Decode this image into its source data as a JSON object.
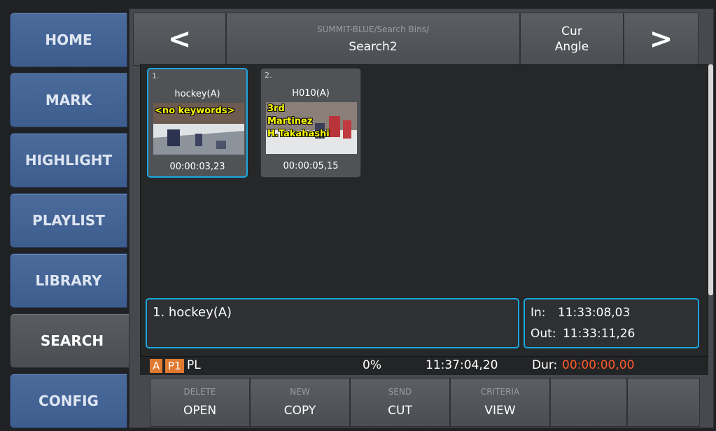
{
  "nav": {
    "items": [
      {
        "label": "HOME"
      },
      {
        "label": "MARK"
      },
      {
        "label": "HIGHLIGHT"
      },
      {
        "label": "PLAYLIST"
      },
      {
        "label": "LIBRARY"
      },
      {
        "label": "SEARCH"
      },
      {
        "label": "CONFIG"
      }
    ],
    "active": "SEARCH"
  },
  "header": {
    "prev_icon": "<",
    "next_icon": ">",
    "path": "SUMMIT-BLUE/Search Bins/",
    "bin": "Search2",
    "angle_line1": "Cur",
    "angle_line2": "Angle"
  },
  "clips": [
    {
      "num": "1.",
      "name": "hockey(A)",
      "keywords": [
        "<no keywords>"
      ],
      "time": "00:00:03,23",
      "selected": true
    },
    {
      "num": "2.",
      "name": "H010(A)",
      "keywords": [
        "3rd",
        "Martinez",
        "H.Takahashi"
      ],
      "time": "00:00:05,15",
      "selected": false
    }
  ],
  "selection": {
    "name": "1. hockey(A)",
    "in_label": "In:",
    "in_time": "11:33:08,03",
    "out_label": "Out:",
    "out_time": "11:33:11,26"
  },
  "status": {
    "tag_a": "A",
    "tag_p1": "P1",
    "pl": "PL",
    "percent": "0%",
    "clock": "11:37:04,20",
    "dur_label": "Dur:",
    "dur_value": "00:00:00,00",
    "dur_color": "#ff5a2a",
    "tag_color": "#e07a30"
  },
  "bottom": [
    {
      "top": "DELETE",
      "main": "OPEN"
    },
    {
      "top": "NEW",
      "main": "COPY"
    },
    {
      "top": "SEND",
      "main": "CUT"
    },
    {
      "top": "CRITERIA",
      "main": "VIEW"
    },
    {
      "top": "",
      "main": ""
    },
    {
      "top": "",
      "main": ""
    }
  ],
  "colors": {
    "accent": "#1aa7e0",
    "nav_blue": "#4b6b9c",
    "panel_gray": "#46494d"
  }
}
